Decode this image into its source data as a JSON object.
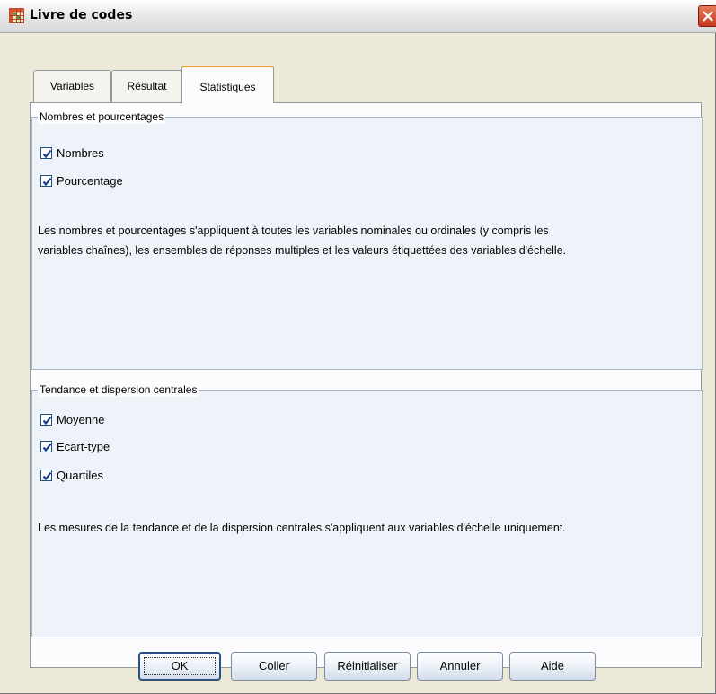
{
  "window": {
    "title": "Livre de codes"
  },
  "tabs": [
    {
      "label": "Variables"
    },
    {
      "label": "Résultat"
    },
    {
      "label": "Statistiques",
      "active": true
    }
  ],
  "groups": {
    "counts": {
      "legend": "Nombres et pourcentages",
      "options": [
        {
          "label": "Nombres",
          "checked": true
        },
        {
          "label": "Pourcentage",
          "checked": true
        }
      ],
      "info": "Les nombres et pourcentages s'appliquent à toutes les variables nominales ou ordinales (y compris les variables chaînes), les ensembles de réponses multiples et les valeurs étiquettées des variables d'échelle."
    },
    "central": {
      "legend": "Tendance et dispersion centrales",
      "options": [
        {
          "label": "Moyenne",
          "checked": true
        },
        {
          "label": "Ecart-type",
          "checked": true
        },
        {
          "label": "Quartiles",
          "checked": true
        }
      ],
      "info": "Les mesures de la tendance et de la dispersion centrales s'appliquent aux variables d'échelle uniquement."
    }
  },
  "buttons": {
    "ok": "OK",
    "paste": "Coller",
    "reset": "Réinitialiser",
    "cancel": "Annuler",
    "help": "Aide"
  },
  "icons": {
    "app": "table-grid-icon",
    "close": "close-icon",
    "check": "checkmark-icon"
  },
  "colors": {
    "tab_accent": "#e69b26",
    "group_bg": "#eef3fa",
    "close_red": "#c7391f"
  }
}
